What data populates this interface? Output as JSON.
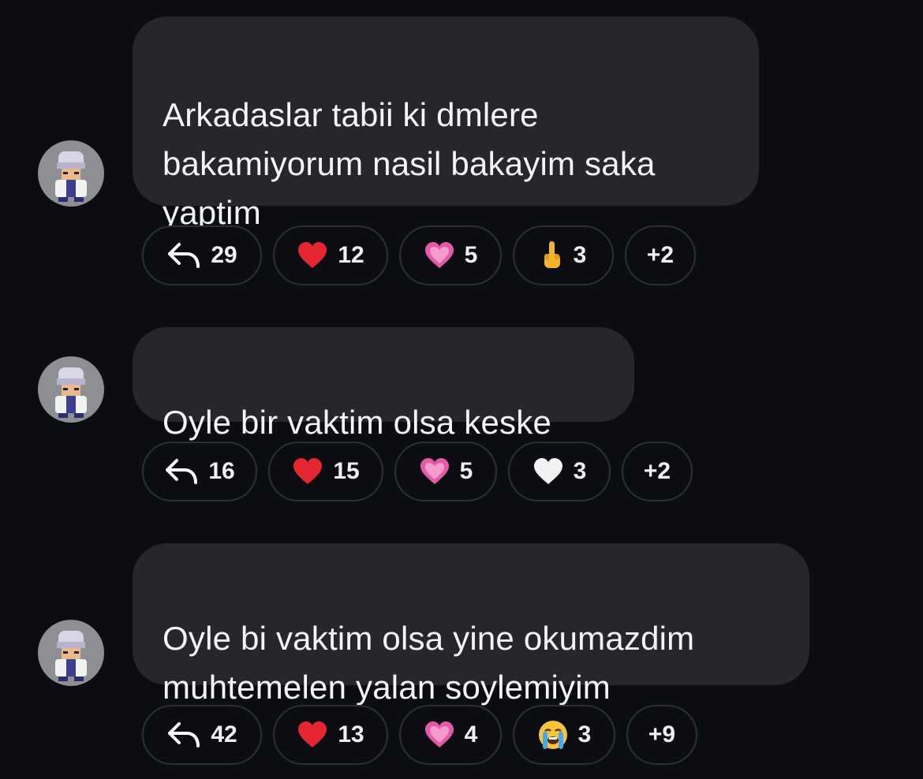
{
  "messages": [
    {
      "text": "Arkadaslar tabii ki dmlere\nbakamiyorum nasil bakayim saka\nyaptim",
      "reply_count": "29",
      "reactions": [
        {
          "icon": "red-heart",
          "count": "12"
        },
        {
          "icon": "pink-heart",
          "count": "5"
        },
        {
          "icon": "middle-finger",
          "count": "3"
        }
      ],
      "more": "+2"
    },
    {
      "text": "Oyle bir vaktim olsa keske",
      "reply_count": "16",
      "reactions": [
        {
          "icon": "red-heart",
          "count": "15"
        },
        {
          "icon": "pink-heart",
          "count": "5"
        },
        {
          "icon": "white-heart",
          "count": "3"
        }
      ],
      "more": "+2"
    },
    {
      "text": "Oyle bi vaktim olsa yine okumazdim\nmuhtemelen yalan soylemiyim",
      "reply_count": "42",
      "reactions": [
        {
          "icon": "red-heart",
          "count": "13"
        },
        {
          "icon": "pink-heart",
          "count": "4"
        },
        {
          "icon": "crying-face",
          "count": "3"
        }
      ],
      "more": "+9"
    }
  ],
  "colors": {
    "background": "#0b0d12",
    "bubble": "#25272c",
    "pill_border": "#2c2f35",
    "red_heart": "#e3262f",
    "pink_heart": "#e55aa7",
    "white_heart": "#f2f2f2"
  }
}
